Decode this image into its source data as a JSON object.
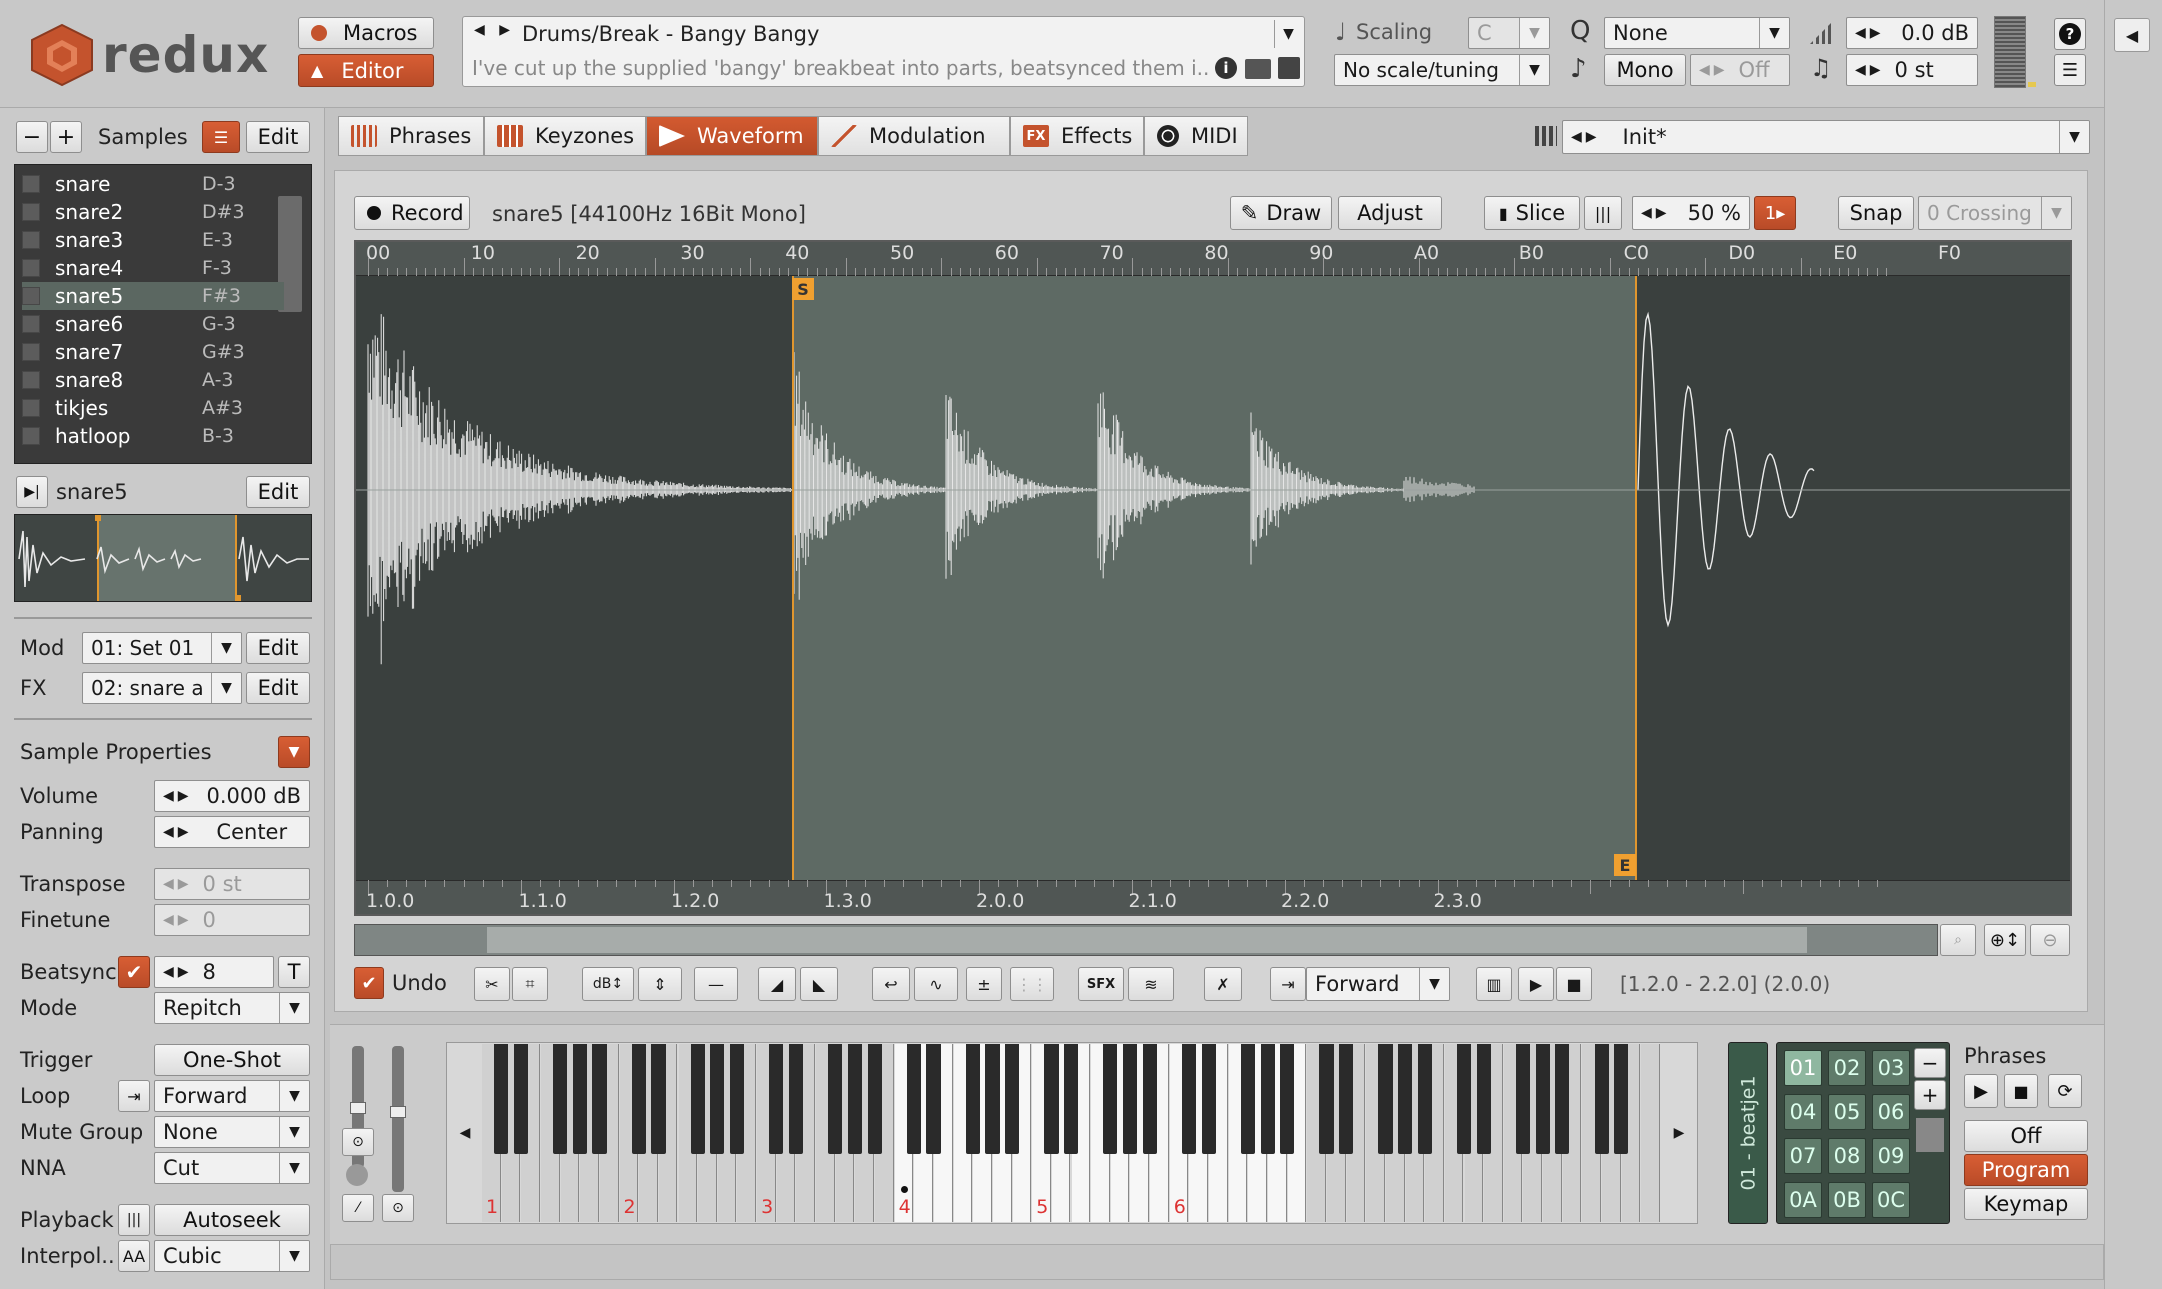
{
  "app": {
    "name": "redux",
    "macros_label": "Macros",
    "editor_label": "Editor"
  },
  "header": {
    "preset_name": "Drums/Break - Bangy Bangy",
    "preset_description": "I've cut up the supplied 'bangy' breakbeat into parts, beatsynced them i..",
    "scaling_label": "Scaling",
    "scaling_key": "C",
    "scale_value": "No scale/tuning",
    "quantize_value": "None",
    "voice_mode": "Mono",
    "glide_value": "Off",
    "volume_value": "0.0 dB",
    "transpose_value": "0 st"
  },
  "samples": {
    "title": "Samples",
    "edit_label": "Edit",
    "items": [
      {
        "name": "snare",
        "note": "D-3"
      },
      {
        "name": "snare2",
        "note": "D#3"
      },
      {
        "name": "snare3",
        "note": "E-3"
      },
      {
        "name": "snare4",
        "note": "F-3"
      },
      {
        "name": "snare5",
        "note": "F#3",
        "selected": true
      },
      {
        "name": "snare6",
        "note": "G-3"
      },
      {
        "name": "snare7",
        "note": "G#3"
      },
      {
        "name": "snare8",
        "note": "A-3"
      },
      {
        "name": "tikjes",
        "note": "A#3"
      },
      {
        "name": "hatloop",
        "note": "B-3"
      }
    ],
    "current": "snare5"
  },
  "mod": {
    "label": "Mod",
    "value": "01: Set 01",
    "edit_label": "Edit"
  },
  "fx": {
    "label": "FX",
    "value": "02: snare a",
    "edit_label": "Edit"
  },
  "props": {
    "title": "Sample Properties",
    "volume_label": "Volume",
    "volume_value": "0.000 dB",
    "panning_label": "Panning",
    "panning_value": "Center",
    "transpose_label": "Transpose",
    "transpose_value": "0 st",
    "finetune_label": "Finetune",
    "finetune_value": "0",
    "beatsync_label": "Beatsync",
    "beatsync_value": "8",
    "beatsync_t": "T",
    "mode_label": "Mode",
    "mode_value": "Repitch",
    "trigger_label": "Trigger",
    "trigger_value": "One-Shot",
    "loop_label": "Loop",
    "loop_value": "Forward",
    "mute_label": "Mute Group",
    "mute_value": "None",
    "nna_label": "NNA",
    "nna_value": "Cut",
    "playback_label": "Playback",
    "playback_value": "Autoseek",
    "interp_label": "Interpol..",
    "interp_icon": "AA",
    "interp_value": "Cubic"
  },
  "tabs": [
    {
      "label": "Phrases",
      "icon": "phrases-icon"
    },
    {
      "label": "Keyzones",
      "icon": "keyzones-icon"
    },
    {
      "label": "Waveform",
      "icon": "waveform-icon",
      "active": true
    },
    {
      "label": "Modulation",
      "icon": "modulation-icon"
    },
    {
      "label": "Effects",
      "icon": "fx-icon",
      "badge": "FX"
    },
    {
      "label": "MIDI",
      "icon": "midi-icon"
    }
  ],
  "program": {
    "value": "Init*"
  },
  "waveform": {
    "record_label": "Record",
    "info": "snare5 [44100Hz 16Bit Mono]",
    "draw_label": "Draw",
    "adjust_label": "Adjust",
    "slice_label": "Slice",
    "slice_percent": "50 %",
    "slice_count": "1",
    "snap_label": "Snap",
    "crossing_label": "0 Crossing",
    "ruler_hex": [
      "00",
      "10",
      "20",
      "30",
      "40",
      "50",
      "60",
      "70",
      "80",
      "90",
      "A0",
      "B0",
      "C0",
      "D0",
      "E0",
      "F0"
    ],
    "ruler_beats": [
      "1.0.0",
      "1.1.0",
      "1.2.0",
      "1.3.0",
      "2.0.0",
      "2.1.0",
      "2.2.0",
      "2.3.0"
    ],
    "start_marker": "S",
    "end_marker": "E",
    "undo_label": "Undo",
    "loop_mode": "Forward",
    "selection_info": "[1.2.0 - 2.2.0] (2.0.0)",
    "tool_labels": {
      "db": "dB",
      "sfx": "SFX",
      "plusminus": "±"
    }
  },
  "keyboard": {
    "octaves": [
      "1",
      "2",
      "3",
      "4",
      "5",
      "6"
    ]
  },
  "phrases": {
    "title": "Phrases",
    "current": "01 - beatje1",
    "slots": [
      "01",
      "02",
      "03",
      "04",
      "05",
      "06",
      "07",
      "08",
      "09",
      "0A",
      "0B",
      "0C"
    ],
    "off_label": "Off",
    "program_label": "Program",
    "keymap_label": "Keymap"
  },
  "colors": {
    "accent": "#c4532d",
    "wave_bg": "#3a403e",
    "wave_sel": "#5e6a64",
    "marker": "#f0a030",
    "dark": "#333"
  }
}
